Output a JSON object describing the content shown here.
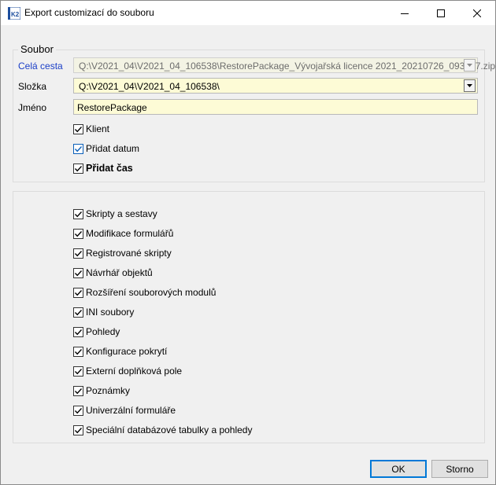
{
  "window": {
    "title": "Export customizací do souboru",
    "app_icon_text": "K2"
  },
  "file_group": {
    "legend": "Soubor",
    "full_path_label": "Celá cesta",
    "full_path_value": "Q:\\V2021_04\\V2021_04_106538\\RestorePackage_Vývojařská licence 2021_20210726_093237.zip",
    "folder_label": "Složka",
    "folder_value": "Q:\\V2021_04\\V2021_04_106538\\",
    "name_label": "Jméno",
    "name_value": "RestorePackage",
    "options": [
      {
        "label": "Klient",
        "checked": true
      },
      {
        "label": "Přidat datum",
        "checked": true
      },
      {
        "label": "Přidat čas",
        "checked": true
      }
    ]
  },
  "content_group": {
    "items": [
      {
        "label": "Skripty a sestavy",
        "checked": true
      },
      {
        "label": "Modifikace formulářů",
        "checked": true
      },
      {
        "label": "Registrované skripty",
        "checked": true
      },
      {
        "label": "Návrhář objektů",
        "checked": true
      },
      {
        "label": "Rozšíření souborových modulů",
        "checked": true
      },
      {
        "label": "INI soubory",
        "checked": true
      },
      {
        "label": "Pohledy",
        "checked": true
      },
      {
        "label": "Konfigurace pokrytí",
        "checked": true
      },
      {
        "label": "Externí doplňková pole",
        "checked": true
      },
      {
        "label": "Poznámky",
        "checked": true
      },
      {
        "label": "Univerzální formuláře",
        "checked": true
      },
      {
        "label": "Speciální databázové tabulky a pohledy",
        "checked": true
      }
    ]
  },
  "buttons": {
    "ok": "OK",
    "cancel": "Storno"
  },
  "colors": {
    "field_bg": "#fdfbd6",
    "link_label": "#1a3ec7",
    "default_button_border": "#0078d7"
  }
}
